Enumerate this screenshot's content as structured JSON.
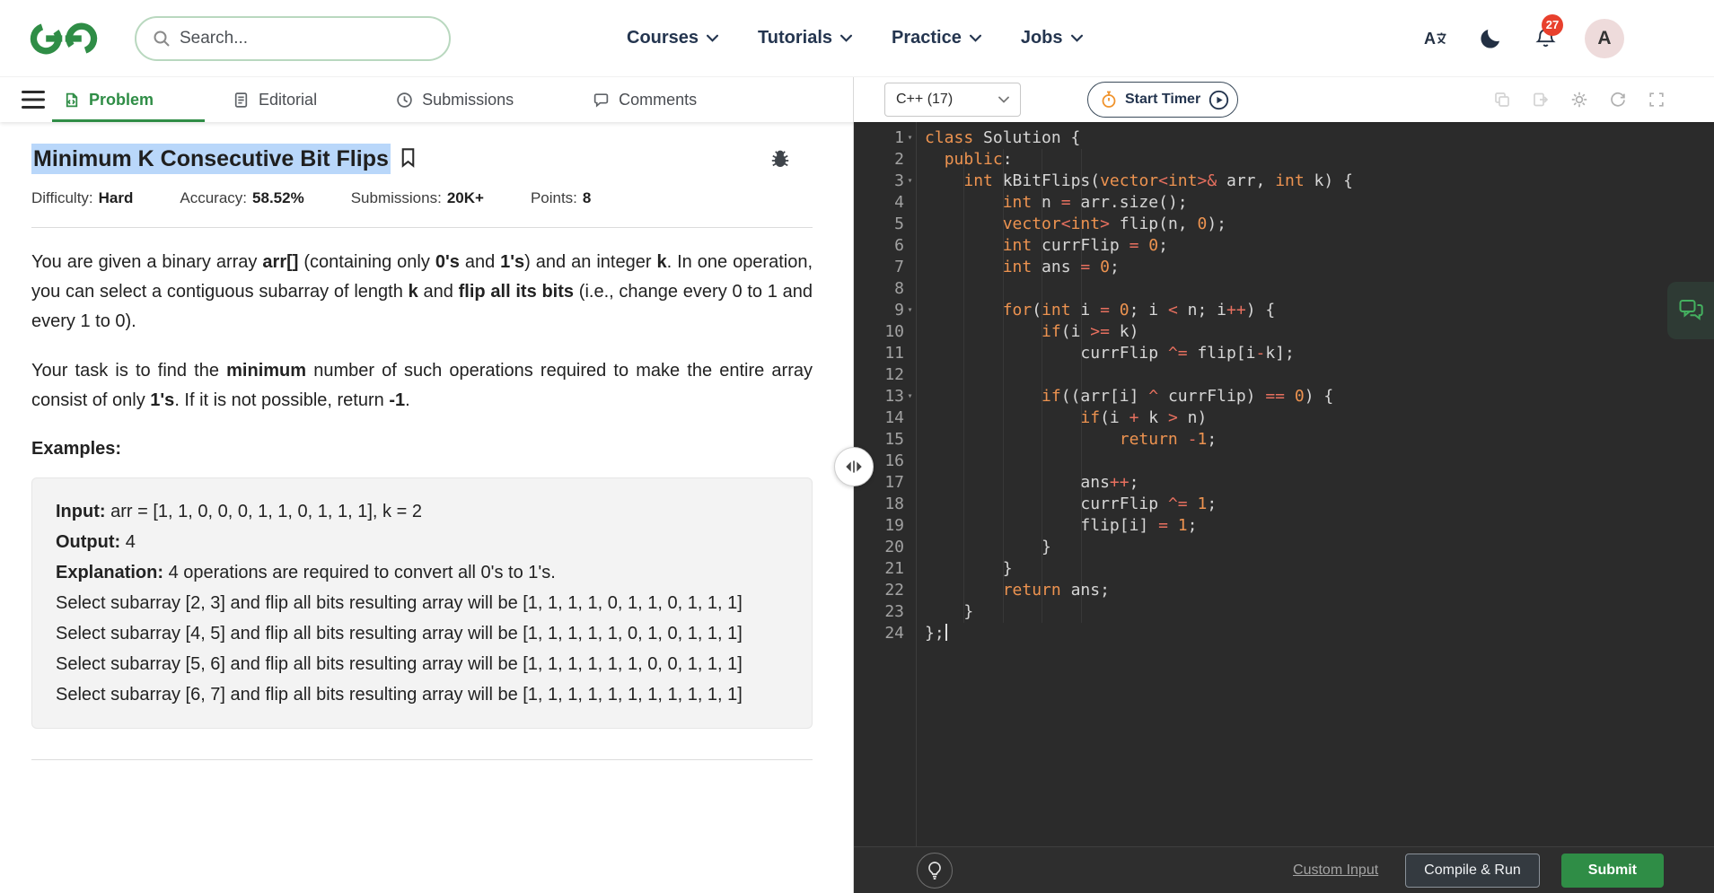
{
  "colors": {
    "accent_green": "#2f8d46",
    "editor_bg": "#2b2b2b",
    "keyword": "#ed9350",
    "operator": "#e8705f",
    "number": "#ed9350",
    "selection_highlight": "#b9d7fa",
    "badge_red": "#e8402d",
    "submit_green": "#2f8d46"
  },
  "icons": [
    "gfg-logo",
    "search-icon",
    "chevron-down-icon",
    "translate-icon",
    "moon-icon",
    "bell-icon",
    "hamburger-icon",
    "problem-icon",
    "editorial-icon",
    "submissions-icon",
    "comments-icon",
    "bookmark-icon",
    "bug-report-icon",
    "stopwatch-icon",
    "play-circle-icon",
    "copy-icon",
    "export-icon",
    "gear-icon",
    "reset-icon",
    "fullscreen-icon",
    "drag-handle-icon",
    "chat-icon",
    "bulb-icon"
  ],
  "navbar": {
    "search_placeholder": "Search...",
    "menu": [
      {
        "label": "Courses"
      },
      {
        "label": "Tutorials"
      },
      {
        "label": "Practice"
      },
      {
        "label": "Jobs"
      }
    ],
    "notification_count": "27",
    "avatar_letter": "A"
  },
  "tabbar": {
    "tabs": [
      {
        "label": "Problem"
      },
      {
        "label": "Editorial"
      },
      {
        "label": "Submissions"
      },
      {
        "label": "Comments"
      }
    ]
  },
  "problem": {
    "title": "Minimum K Consecutive Bit Flips",
    "meta": [
      {
        "label": "Difficulty:",
        "value": "Hard"
      },
      {
        "label": "Accuracy:",
        "value": "58.52%"
      },
      {
        "label": "Submissions:",
        "value": "20K+"
      },
      {
        "label": "Points:",
        "value": "8"
      }
    ],
    "paragraphs": [
      [
        {
          "t": "You are given a binary array "
        },
        {
          "t": "arr[]",
          "b": true
        },
        {
          "t": " (containing only "
        },
        {
          "t": "0's",
          "b": true
        },
        {
          "t": " and "
        },
        {
          "t": "1's",
          "b": true
        },
        {
          "t": ") and an integer "
        },
        {
          "t": "k",
          "b": true
        },
        {
          "t": ". In one operation, you can select a contiguous subarray of length "
        },
        {
          "t": "k",
          "b": true
        },
        {
          "t": " and "
        },
        {
          "t": "flip all its bits",
          "b": true
        },
        {
          "t": " (i.e., change every 0 to 1 and every 1 to 0)."
        }
      ],
      [
        {
          "t": "Your task is to find the "
        },
        {
          "t": "minimum",
          "b": true
        },
        {
          "t": " number of such operations required to make the entire array consist of only "
        },
        {
          "t": "1's",
          "b": true
        },
        {
          "t": ". If it is not possible, return "
        },
        {
          "t": "-1",
          "b": true
        },
        {
          "t": "."
        }
      ]
    ],
    "examples_heading": "Examples:",
    "example_lines": [
      [
        {
          "t": "Input: ",
          "b": true
        },
        {
          "t": "arr = [1, 1, 0, 0, 0, 1, 1, 0, 1, 1, 1], k = 2"
        }
      ],
      [
        {
          "t": "Output: ",
          "b": true
        },
        {
          "t": "4"
        }
      ],
      [
        {
          "t": "Explanation: ",
          "b": true
        },
        {
          "t": "4 operations are required to convert all 0's to 1's."
        }
      ],
      [
        {
          "t": "Select subarray [2, 3] and flip all bits resulting array will be [1, 1, 1, 1, 0, 1, 1, 0, 1, 1, 1]"
        }
      ],
      [
        {
          "t": "Select subarray [4, 5] and flip all bits resulting array will be [1, 1, 1, 1, 1, 0, 1, 0, 1, 1, 1]"
        }
      ],
      [
        {
          "t": "Select subarray [5, 6] and flip all bits resulting array will be [1, 1, 1, 1, 1, 1, 0, 0, 1, 1, 1]"
        }
      ],
      [
        {
          "t": "Select subarray [6, 7] and flip all bits resulting array will be [1, 1, 1, 1, 1, 1, 1, 1, 1, 1, 1]"
        }
      ]
    ]
  },
  "editor": {
    "language": "C++ (17)",
    "start_timer_label": "Start Timer",
    "footer": {
      "custom_input": "Custom Input",
      "compile_run": "Compile & Run",
      "submit": "Submit"
    },
    "code_lines": [
      {
        "n": 1,
        "fold": true,
        "tokens": [
          {
            "c": "k",
            "t": "class"
          },
          {
            "c": "p",
            "t": " Solution {"
          }
        ]
      },
      {
        "n": 2,
        "tokens": [
          {
            "c": "p",
            "t": "  "
          },
          {
            "c": "k",
            "t": "public"
          },
          {
            "c": "p",
            "t": ":"
          }
        ]
      },
      {
        "n": 3,
        "fold": true,
        "tokens": [
          {
            "c": "p",
            "t": "    "
          },
          {
            "c": "k",
            "t": "int"
          },
          {
            "c": "p",
            "t": " kBitFlips("
          },
          {
            "c": "k",
            "t": "vector"
          },
          {
            "c": "o",
            "t": "<"
          },
          {
            "c": "k",
            "t": "int"
          },
          {
            "c": "o",
            "t": ">&"
          },
          {
            "c": "p",
            "t": " arr, "
          },
          {
            "c": "k",
            "t": "int"
          },
          {
            "c": "p",
            "t": " k) {"
          }
        ]
      },
      {
        "n": 4,
        "tokens": [
          {
            "c": "p",
            "t": "        "
          },
          {
            "c": "k",
            "t": "int"
          },
          {
            "c": "p",
            "t": " n "
          },
          {
            "c": "o",
            "t": "="
          },
          {
            "c": "p",
            "t": " arr.size();"
          }
        ]
      },
      {
        "n": 5,
        "tokens": [
          {
            "c": "p",
            "t": "        "
          },
          {
            "c": "k",
            "t": "vector"
          },
          {
            "c": "o",
            "t": "<"
          },
          {
            "c": "k",
            "t": "int"
          },
          {
            "c": "o",
            "t": ">"
          },
          {
            "c": "p",
            "t": " flip(n, "
          },
          {
            "c": "n",
            "t": "0"
          },
          {
            "c": "p",
            "t": ");"
          }
        ]
      },
      {
        "n": 6,
        "tokens": [
          {
            "c": "p",
            "t": "        "
          },
          {
            "c": "k",
            "t": "int"
          },
          {
            "c": "p",
            "t": " currFlip "
          },
          {
            "c": "o",
            "t": "="
          },
          {
            "c": "p",
            "t": " "
          },
          {
            "c": "n",
            "t": "0"
          },
          {
            "c": "p",
            "t": ";"
          }
        ]
      },
      {
        "n": 7,
        "tokens": [
          {
            "c": "p",
            "t": "        "
          },
          {
            "c": "k",
            "t": "int"
          },
          {
            "c": "p",
            "t": " ans "
          },
          {
            "c": "o",
            "t": "="
          },
          {
            "c": "p",
            "t": " "
          },
          {
            "c": "n",
            "t": "0"
          },
          {
            "c": "p",
            "t": ";"
          }
        ]
      },
      {
        "n": 8,
        "tokens": []
      },
      {
        "n": 9,
        "fold": true,
        "tokens": [
          {
            "c": "p",
            "t": "        "
          },
          {
            "c": "k",
            "t": "for"
          },
          {
            "c": "p",
            "t": "("
          },
          {
            "c": "k",
            "t": "int"
          },
          {
            "c": "p",
            "t": " i "
          },
          {
            "c": "o",
            "t": "="
          },
          {
            "c": "p",
            "t": " "
          },
          {
            "c": "n",
            "t": "0"
          },
          {
            "c": "p",
            "t": "; i "
          },
          {
            "c": "o",
            "t": "<"
          },
          {
            "c": "p",
            "t": " n; i"
          },
          {
            "c": "o",
            "t": "++"
          },
          {
            "c": "p",
            "t": ") {"
          }
        ]
      },
      {
        "n": 10,
        "tokens": [
          {
            "c": "p",
            "t": "            "
          },
          {
            "c": "k",
            "t": "if"
          },
          {
            "c": "p",
            "t": "(i "
          },
          {
            "c": "o",
            "t": ">="
          },
          {
            "c": "p",
            "t": " k)"
          }
        ]
      },
      {
        "n": 11,
        "tokens": [
          {
            "c": "p",
            "t": "                currFlip "
          },
          {
            "c": "o",
            "t": "^="
          },
          {
            "c": "p",
            "t": " flip[i"
          },
          {
            "c": "o",
            "t": "-"
          },
          {
            "c": "p",
            "t": "k];"
          }
        ]
      },
      {
        "n": 12,
        "tokens": []
      },
      {
        "n": 13,
        "fold": true,
        "tokens": [
          {
            "c": "p",
            "t": "            "
          },
          {
            "c": "k",
            "t": "if"
          },
          {
            "c": "p",
            "t": "((arr[i] "
          },
          {
            "c": "o",
            "t": "^"
          },
          {
            "c": "p",
            "t": " currFlip) "
          },
          {
            "c": "o",
            "t": "=="
          },
          {
            "c": "p",
            "t": " "
          },
          {
            "c": "n",
            "t": "0"
          },
          {
            "c": "p",
            "t": ") {"
          }
        ]
      },
      {
        "n": 14,
        "tokens": [
          {
            "c": "p",
            "t": "                "
          },
          {
            "c": "k",
            "t": "if"
          },
          {
            "c": "p",
            "t": "(i "
          },
          {
            "c": "o",
            "t": "+"
          },
          {
            "c": "p",
            "t": " k "
          },
          {
            "c": "o",
            "t": ">"
          },
          {
            "c": "p",
            "t": " n)"
          }
        ]
      },
      {
        "n": 15,
        "tokens": [
          {
            "c": "p",
            "t": "                    "
          },
          {
            "c": "k",
            "t": "return"
          },
          {
            "c": "p",
            "t": " "
          },
          {
            "c": "o",
            "t": "-"
          },
          {
            "c": "n",
            "t": "1"
          },
          {
            "c": "p",
            "t": ";"
          }
        ]
      },
      {
        "n": 16,
        "tokens": []
      },
      {
        "n": 17,
        "tokens": [
          {
            "c": "p",
            "t": "                ans"
          },
          {
            "c": "o",
            "t": "++"
          },
          {
            "c": "p",
            "t": ";"
          }
        ]
      },
      {
        "n": 18,
        "tokens": [
          {
            "c": "p",
            "t": "                currFlip "
          },
          {
            "c": "o",
            "t": "^="
          },
          {
            "c": "p",
            "t": " "
          },
          {
            "c": "n",
            "t": "1"
          },
          {
            "c": "p",
            "t": ";"
          }
        ]
      },
      {
        "n": 19,
        "tokens": [
          {
            "c": "p",
            "t": "                flip[i] "
          },
          {
            "c": "o",
            "t": "="
          },
          {
            "c": "p",
            "t": " "
          },
          {
            "c": "n",
            "t": "1"
          },
          {
            "c": "p",
            "t": ";"
          }
        ]
      },
      {
        "n": 20,
        "tokens": [
          {
            "c": "p",
            "t": "            }"
          }
        ]
      },
      {
        "n": 21,
        "tokens": [
          {
            "c": "p",
            "t": "        }"
          }
        ]
      },
      {
        "n": 22,
        "tokens": [
          {
            "c": "p",
            "t": "        "
          },
          {
            "c": "k",
            "t": "return"
          },
          {
            "c": "p",
            "t": " ans;"
          }
        ]
      },
      {
        "n": 23,
        "tokens": [
          {
            "c": "p",
            "t": "    }"
          }
        ]
      },
      {
        "n": 24,
        "cursor": true,
        "tokens": [
          {
            "c": "p",
            "t": "};"
          }
        ]
      }
    ]
  }
}
